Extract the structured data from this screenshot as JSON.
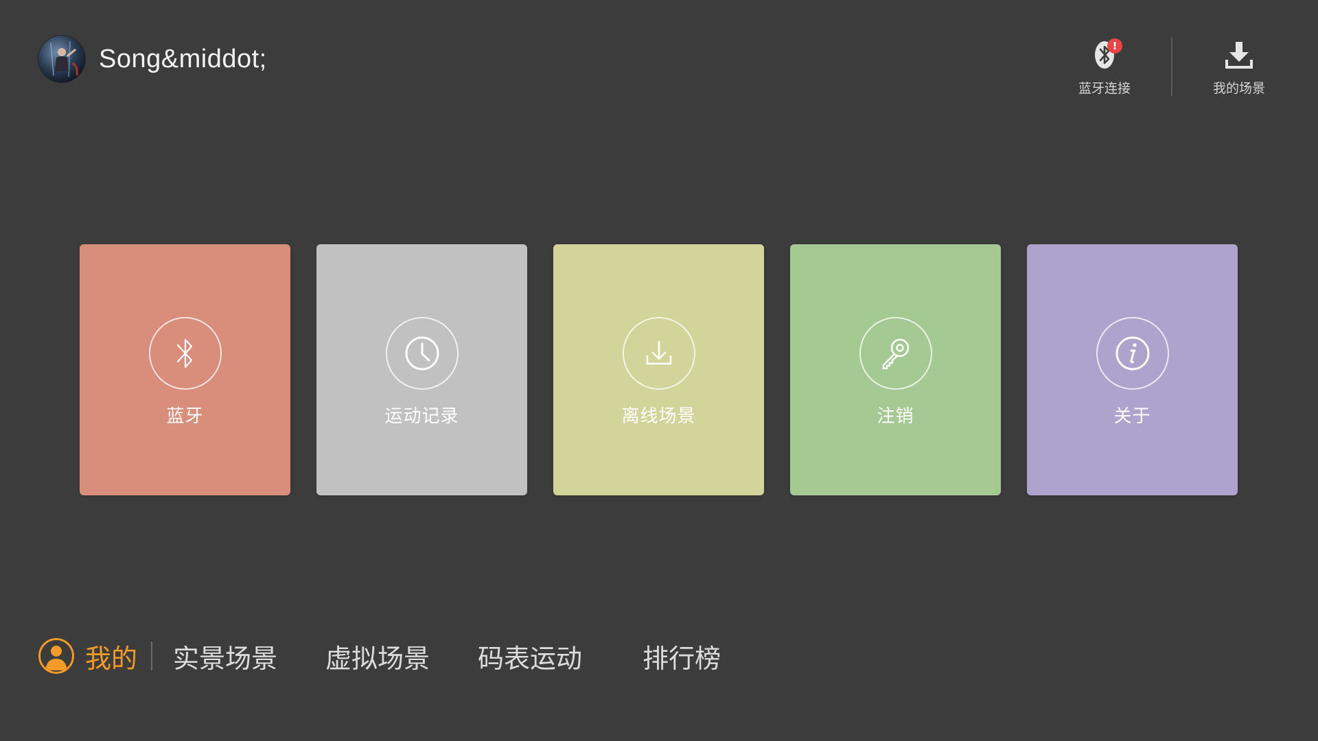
{
  "header": {
    "username": "Song&middot;",
    "actions": [
      {
        "label": "蓝牙连接",
        "icon": "bluetooth-icon",
        "badge": "!"
      },
      {
        "label": "我的场景",
        "icon": "download-icon"
      }
    ]
  },
  "tiles": [
    {
      "label": "蓝牙",
      "icon": "bluetooth-icon",
      "color": "#d98d7b"
    },
    {
      "label": "运动记录",
      "icon": "clock-icon",
      "color": "#c1c1c1"
    },
    {
      "label": "离线场景",
      "icon": "download-icon",
      "color": "#d3d499"
    },
    {
      "label": "注销",
      "icon": "key-icon",
      "color": "#a4c992"
    },
    {
      "label": "关于",
      "icon": "info-icon",
      "color": "#ada3cd"
    }
  ],
  "bottom_nav": {
    "active": {
      "label": "我的",
      "icon": "user-icon",
      "color": "#f39a28"
    },
    "items": [
      {
        "label": "实景场景"
      },
      {
        "label": "虚拟场景"
      },
      {
        "label": "码表运动"
      },
      {
        "label": "排行榜"
      }
    ]
  }
}
